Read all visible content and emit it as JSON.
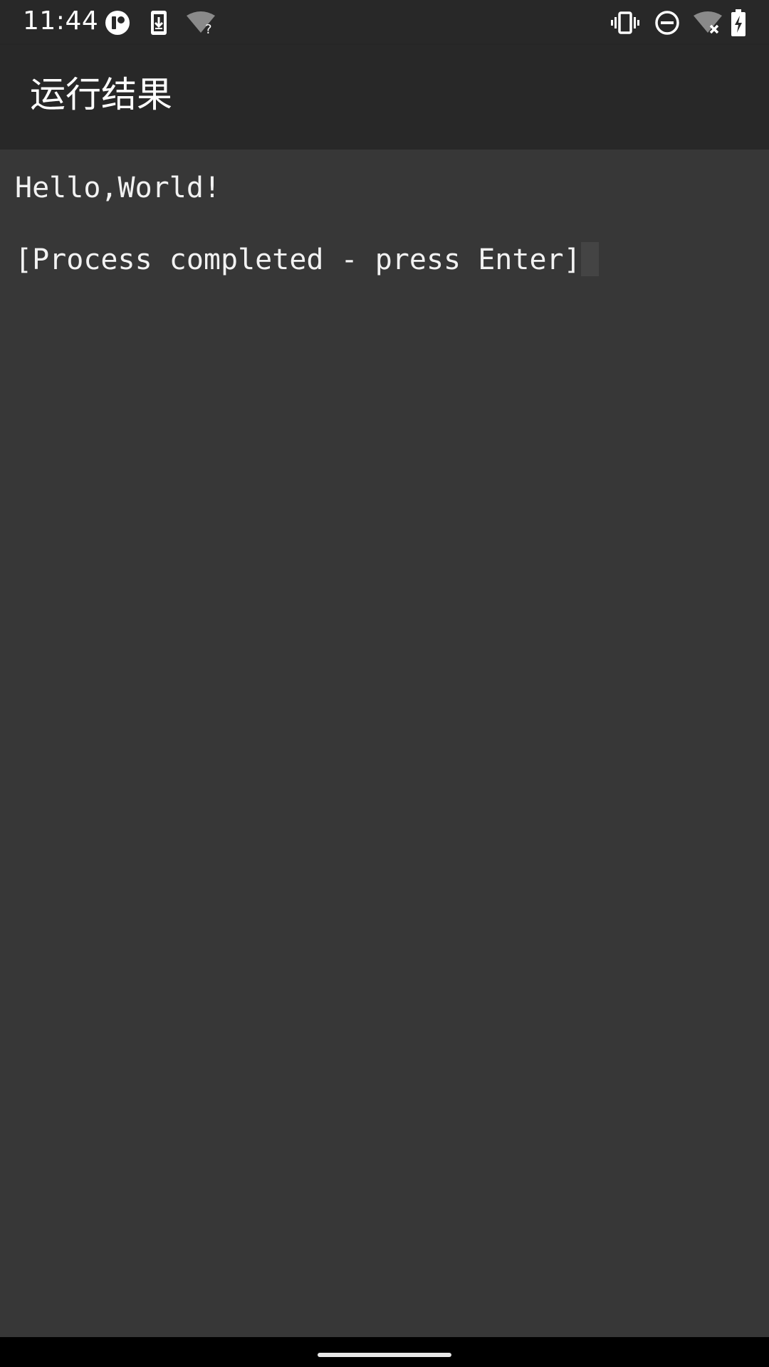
{
  "status_bar": {
    "time": "11:44",
    "left_icons": [
      "app-notification-icon",
      "download-icon",
      "wifi-unknown-icon"
    ],
    "right_icons": [
      "vibrate-icon",
      "do-not-disturb-icon",
      "wifi-no-internet-icon",
      "battery-charging-icon"
    ]
  },
  "app_bar": {
    "title": "运行结果"
  },
  "terminal": {
    "lines": [
      "Hello,World!",
      "[Process completed - press Enter]"
    ]
  },
  "colors": {
    "background": "#373737",
    "app_bar": "#282828",
    "text": "#f2f2f2"
  }
}
